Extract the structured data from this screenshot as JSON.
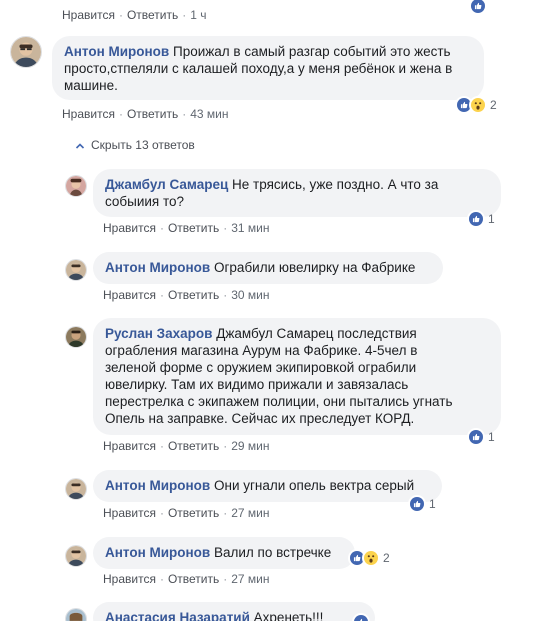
{
  "top_actions": {
    "like": "Нравится",
    "reply": "Ответить",
    "time": "1 ч"
  },
  "comments": [
    {
      "author": "Антон Миронов",
      "text_lines": [
        "Проижал в самый разгар событий это жесть",
        "просто,стпеляли с калашей походу,а у меня ребёнок и жена в",
        "машине."
      ],
      "like": "Нравится",
      "reply": "Ответить",
      "time": "43 мин",
      "reaction_count": "2"
    }
  ],
  "toggle_label": "Скрыть 13 ответов",
  "replies": [
    {
      "author": "Джамбул Самарец",
      "text_lines": [
        "Не трясись, уже поздно. А что за",
        "собыиия то?"
      ],
      "like": "Нравится",
      "reply": "Ответить",
      "time": "31 мин",
      "reaction_count": "1"
    },
    {
      "author": "Антон Миронов",
      "text_lines": [
        "Ограбили ювелирку на Фабрике"
      ],
      "like": "Нравится",
      "reply": "Ответить",
      "time": "30 мин"
    },
    {
      "author": "Руслан Захаров",
      "text_lines": [
        "Джамбул Самарец последствия",
        "ограбления магазина Аурум на Фабрике. 4-5чел в",
        "зеленой форме с оружием экипировкой ограбили",
        "ювелирку. Там их видимо прижали и завязалась",
        "перестрелка с экипажем полиции, они пытались угнать",
        "Опель на заправке. Сейчас их преследует КОРД."
      ],
      "like": "Нравится",
      "reply": "Ответить",
      "time": "29 мин",
      "reaction_count": "1"
    },
    {
      "author": "Антон Миронов",
      "text_lines": [
        "Они угнали опель вектра серый"
      ],
      "like": "Нравится",
      "reply": "Ответить",
      "time": "27 мин",
      "reaction_count": "1"
    },
    {
      "author": "Антон Миронов",
      "text_lines": [
        "Валил по встречке"
      ],
      "like": "Нравится",
      "reply": "Ответить",
      "time": "27 мин",
      "reaction_count": "2"
    },
    {
      "author": "Анастасия Назаратий",
      "text_lines": [
        "Ахренеть!!!"
      ]
    }
  ],
  "colors": {
    "like_blue": "#4267b2",
    "author": "#385898",
    "bubble": "#f2f3f5",
    "wow_yellow": "#fcd34d"
  }
}
